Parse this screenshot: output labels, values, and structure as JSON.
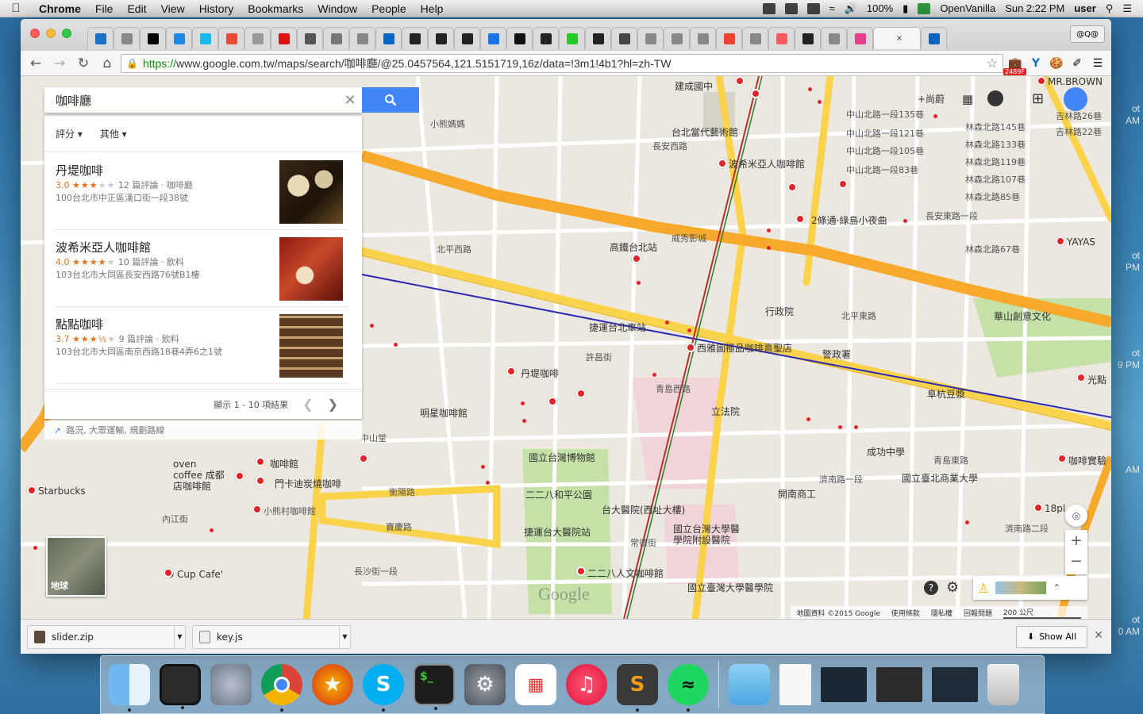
{
  "menubar": {
    "app_name": "Chrome",
    "items": [
      "File",
      "Edit",
      "View",
      "History",
      "Bookmarks",
      "Window",
      "People",
      "Help"
    ],
    "battery": "100%",
    "input_method": "OpenVanilla",
    "clock": "Sun 2:22 PM",
    "user": "user"
  },
  "browser": {
    "profile_label": "@Q@",
    "active_tab_close": "×",
    "url_scheme": "https://",
    "url_rest": "www.google.com.tw/maps/search/咖啡廳/@25.0457564,121.5151719,16z/data=!3m1!4b1?hl=zh-TW",
    "badge_count": "2489F"
  },
  "search": {
    "query": "咖啡廳",
    "filter_rating": "評分 ▾",
    "filter_other": "其他 ▾"
  },
  "results": [
    {
      "name": "丹堤咖啡",
      "score": "3.0",
      "stars_on": "★★★",
      "stars_off": "★★",
      "reviews": "12 篇評論 · 咖啡廳",
      "address": "100台北市中正區漢口街一段38號"
    },
    {
      "name": "波希米亞人咖啡館",
      "score": "4.0",
      "stars_on": "★★★★",
      "stars_off": "★",
      "reviews": "10 篇評論 · 飲料",
      "address": "103台北市大同區長安西路76號B1樓"
    },
    {
      "name": "點點咖啡",
      "score": "3.7",
      "stars_on": "★★★½",
      "stars_off": "★",
      "reviews": "9 篇評論 · 飲料",
      "address": "103台北市大同區南京西路18巷4弄6之1號"
    }
  ],
  "pager_text": "顯示 1 - 10 項結果",
  "directions_hint": "路況, 大眾運輸, 規劃路線",
  "earth_label": "地球",
  "map_labels": [
    "建成國中",
    "台北當代藝術館",
    "長安西路",
    "波希米亞人咖啡館",
    "小熊媽媽",
    "2條通·綠島小夜曲",
    "高鐵台北站",
    "北平西路",
    "威秀影城",
    "捷運台北車站",
    "西雅圖極品咖啡熹聖店",
    "行政院",
    "北平東路",
    "華山創意文化",
    "丹堤咖啡",
    "許昌街",
    "青島西路",
    "警政署",
    "阜杭豆漿",
    "明星咖啡館",
    "立法院",
    "成功中學",
    "國立臺北商業大學",
    "國立台灣博物館",
    "二二八和平公園",
    "台大醫院(西址大樓)",
    "國立台灣大學醫學院附設醫院",
    "捷運台大醫院站",
    "二二八人文咖啡館",
    "國立臺灣大學醫學院",
    "oven coffee 成都店咖啡館",
    "咖啡館",
    "門卡迪炭燒咖啡",
    "Starbucks",
    "小熊村咖啡館",
    "D Cup Cafe'",
    "衡陽路",
    "寶慶路",
    "中山堂",
    "內江街",
    "開南商工",
    "MR.BROWN",
    "+尚蔚",
    "吉林路26巷",
    "吉林路22巷",
    "YAYAS",
    "光點",
    "咖啡實驗",
    "18pl",
    "中山北路一段135巷",
    "中山北路一段121巷",
    "中山北路一段105巷",
    "中山北路一段83巷",
    "林森北路145巷",
    "林森北路133巷",
    "林森北路119巷",
    "林森北路107巷",
    "林森北路85巷",
    "林森北路67巷",
    "長安東路一段",
    "濟南路一段",
    "濟南路二段",
    "青島東路",
    "常德街",
    "長沙街一段"
  ],
  "map_footer": {
    "data": "地圖資料 ©2015 Google",
    "terms": "使用條款",
    "privacy": "隱私權",
    "report": "回報問題",
    "scale": "200 公尺"
  },
  "map_logo": "Google",
  "downloads": {
    "items": [
      "slider.zip",
      "key.js"
    ],
    "show_all": "Show All"
  },
  "desktop_edge": {
    "line1a": "ot",
    "line1b": "AM",
    "line2a": "ot",
    "line2b": "PM",
    "line3a": "ot",
    "line3b": "9 PM",
    "line4a": "AM",
    "line5a": "ot",
    "line5b": "0 AM"
  },
  "colors": {
    "highway": "#f7a92c",
    "main_road": "#fbd34a",
    "park": "#c6e1a8",
    "hospital": "#f0d4d8",
    "poi_red": "#e0262b",
    "search_blue": "#4285f4",
    "rating_orange": "#e7711b"
  }
}
